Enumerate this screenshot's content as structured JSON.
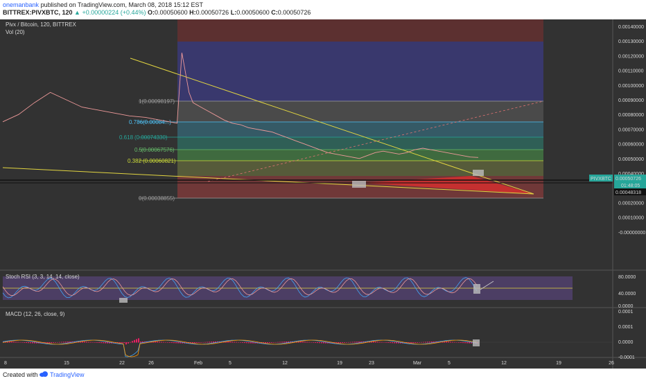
{
  "header": {
    "author": "onemanbank",
    "published": "published on TradingView.com, March 08, 2018 15:12 EST",
    "symbol_line": "BITTREX:PIVXBTC, 120",
    "change": "▲ +0.00000224 (+0.44%)",
    "ohlc": {
      "o_label": "O:",
      "o": "0.00050600",
      "h_label": "H:",
      "h": "0.00050726",
      "l_label": "L:",
      "l": "0.00050600",
      "c_label": "C:",
      "c": "0.00050726"
    }
  },
  "legend": {
    "main": "Pivx / Bitcoin, 120, BITTREX",
    "vol": "Vol (20)",
    "stoch": "Stoch RSI (3, 3, 14, 14, close)",
    "macd": "MACD (12, 26, close, 9)"
  },
  "price_axis": {
    "ticks": [
      "0.00140000",
      "0.00130000",
      "0.00120000",
      "0.00110000",
      "0.00100000",
      "0.00090000",
      "0.00080000",
      "0.00070000",
      "0.00060000",
      "0.00050000",
      "0.00040000",
      "0.00030000",
      "0.00020000",
      "0.00010000",
      "-0.00000000"
    ]
  },
  "labels": {
    "symbol_tag": "PIVXBTC",
    "last_price": "0.00050726",
    "countdown": "01:48:05",
    "crosshair_price": "0.00048318"
  },
  "fib_levels": [
    {
      "ratio_label": "",
      "text": "1(0.00098197)",
      "price": 0.00098197
    },
    {
      "ratio_label": "0.786",
      "text": "(0.00084...)",
      "price": 0.00084
    },
    {
      "ratio_label": "0.618",
      "text": "(0.00074330)",
      "price": 0.0007433
    },
    {
      "ratio_label": "0.5",
      "text": "(0.00067576)",
      "price": 0.00067576
    },
    {
      "ratio_label": "0.382",
      "text": "(0.00060821)",
      "price": 0.00060821
    },
    {
      "ratio_label": "",
      "text": "0(0.00038855)",
      "price": 0.00038855
    }
  ],
  "stoch_axis": {
    "ticks": [
      "80.0000",
      "40.0000",
      "0.0000"
    ]
  },
  "macd_axis": {
    "ticks": [
      "0.0001",
      "0.0001",
      "0.0000",
      "-0.0001"
    ]
  },
  "time_axis": {
    "ticks": [
      "8",
      "15",
      "22",
      "26",
      "Feb",
      "5",
      "12",
      "19",
      "23",
      "Mar",
      "5",
      "12",
      "19",
      "26"
    ]
  },
  "footer": {
    "created": "Created with",
    "brand": "TradingView"
  },
  "colors": {
    "background": "#323232",
    "up": "#26a69a",
    "down": "#ef5350",
    "trendline": "#e3d641",
    "stoch_band": "#7e57c2"
  },
  "chart_data": {
    "type": "line",
    "title": "Pivx / Bitcoin, 120, BITTREX",
    "ylim": [
      -1e-05,
      0.00145
    ],
    "x_ticks": [
      "8",
      "15",
      "22",
      "26",
      "Feb",
      "5",
      "12",
      "19",
      "23",
      "Mar",
      "5",
      "12",
      "19",
      "26"
    ],
    "series": [
      {
        "name": "PIVXBTC",
        "x": [
          0,
          2,
          4,
          6,
          8,
          10,
          12,
          14,
          16,
          18,
          20,
          22,
          22.6,
          23,
          23.5,
          24,
          25,
          26,
          27,
          28,
          29,
          30,
          31,
          32,
          33,
          34,
          35,
          36,
          37,
          38,
          39,
          40,
          41,
          42,
          43,
          44,
          45,
          46,
          47,
          48,
          49,
          50,
          51,
          52,
          53,
          54,
          55,
          56,
          57,
          58,
          59,
          60
        ],
        "values": [
          0.00075,
          0.0008,
          0.00088,
          0.00095,
          0.0009,
          0.00085,
          0.00083,
          0.00081,
          0.00079,
          0.00078,
          0.00076,
          0.00074,
          0.00122,
          0.0011,
          0.00095,
          0.00088,
          0.00085,
          0.00082,
          0.00079,
          0.00076,
          0.00074,
          0.00073,
          0.00071,
          0.0007,
          0.00069,
          0.00068,
          0.00066,
          0.00064,
          0.00062,
          0.0006,
          0.00058,
          0.00056,
          0.00054,
          0.00053,
          0.00052,
          0.00051,
          0.0005,
          0.00052,
          0.00054,
          0.00055,
          0.00054,
          0.00053,
          0.00054,
          0.00056,
          0.00057,
          0.00056,
          0.00055,
          0.00054,
          0.00053,
          0.00052,
          0.00051,
          0.00050726
        ]
      }
    ]
  }
}
